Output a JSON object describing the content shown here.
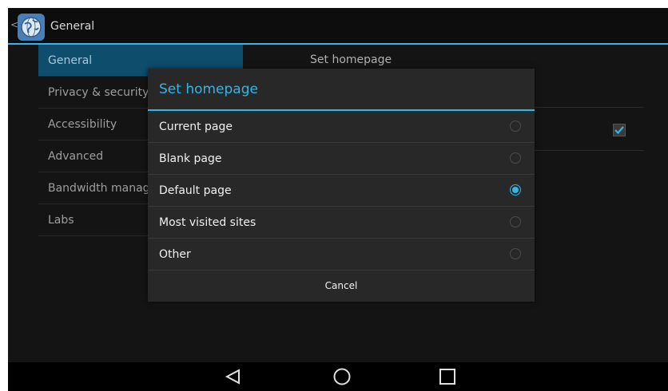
{
  "actionbar": {
    "title": "General",
    "caret": "<",
    "icon": "globe-icon"
  },
  "settings": {
    "categories": [
      {
        "label": "General",
        "selected": true
      },
      {
        "label": "Privacy & security",
        "selected": false
      },
      {
        "label": "Accessibility",
        "selected": false
      },
      {
        "label": "Advanced",
        "selected": false
      },
      {
        "label": "Bandwidth management",
        "selected": false
      },
      {
        "label": "Labs",
        "selected": false
      }
    ],
    "right_header": "Set homepage"
  },
  "dialog": {
    "title": "Set homepage",
    "options": [
      {
        "label": "Current page",
        "checked": false
      },
      {
        "label": "Blank page",
        "checked": false
      },
      {
        "label": "Default page",
        "checked": true
      },
      {
        "label": "Most visited sites",
        "checked": false
      },
      {
        "label": "Other",
        "checked": false
      }
    ],
    "cancel_label": "Cancel"
  },
  "navbar": {
    "icons": [
      "back-icon",
      "home-icon",
      "recents-icon"
    ]
  },
  "colors": {
    "accent": "#33b5e5",
    "selected_bg": "#0e4d6b",
    "dialog_bg": "#282828"
  }
}
